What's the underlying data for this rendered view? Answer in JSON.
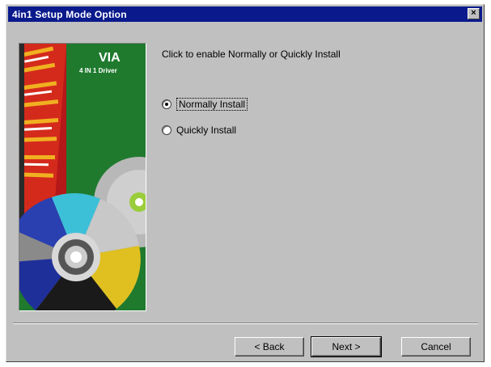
{
  "window": {
    "title": "4in1 Setup Mode Option",
    "close_label": "×"
  },
  "banner": {
    "brand": "VIA",
    "subtitle": "4 IN 1 Driver"
  },
  "instruction": "Click to enable Normally or Quickly Install",
  "options": [
    {
      "label": "Normally Install",
      "selected": true
    },
    {
      "label": "Quickly Install",
      "selected": false
    }
  ],
  "buttons": {
    "back": "< Back",
    "next": "Next >",
    "cancel": "Cancel"
  },
  "colors": {
    "titlebar": "#0a1a8c",
    "face": "#c0c0c0",
    "banner_green": "#1f7a2e"
  }
}
